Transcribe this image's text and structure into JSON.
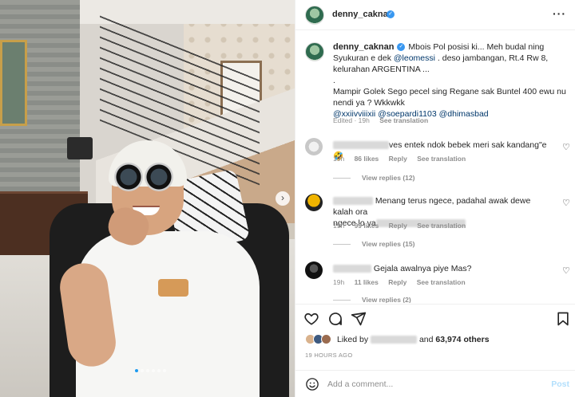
{
  "post": {
    "username": "denny_caknan",
    "caption_username": "denny_caknan",
    "caption_part1": "Mbois Pol posisi ki... Meh budal ning Syukuran e dek ",
    "mention_messi": "@leomessi",
    "caption_part2": " . deso jambangan, Rt.4 Rw 8, kelurahan ARGENTINA ...",
    "caption_dot": ".",
    "caption_part3": "Mampir Golek Sego pecel sing Regane sak Buntel 400 ewu nu nendi ya ? Wkkwkk",
    "mentions": [
      "@xxiivviiixii",
      "@soepardi1103",
      "@dhimasbad"
    ],
    "edited": "Edited · 19h",
    "see_translation": "See translation"
  },
  "comments": [
    {
      "text_suffix": "ves entek ndok bebek meri sak kandang\"e 🤣",
      "time": "19h",
      "likes": "86 likes",
      "reply": "Reply",
      "translation": "See translation",
      "view_replies": "View replies (12)"
    },
    {
      "text_line1": "Menang terus ngece, padahal awak dewe kalah ora",
      "text_line2": "ngece lo ya",
      "time": "19h",
      "likes": "99 likes",
      "reply": "Reply",
      "translation": "See translation",
      "view_replies": "View replies (15)"
    },
    {
      "text": "Gejala awalnya piye Mas?",
      "time": "19h",
      "likes": "11 likes",
      "reply": "Reply",
      "translation": "See translation",
      "view_replies": "View replies (2)"
    }
  ],
  "likes": {
    "prefix": "Liked by",
    "and": "and",
    "count": "63,974 others"
  },
  "time_ago": "19 HOURS AGO",
  "add_comment": {
    "placeholder": "Add a comment...",
    "post_label": "Post"
  },
  "icons": {
    "more": "more-icon",
    "next": "chevron-right-icon",
    "heart": "heart-icon",
    "comment": "comment-icon",
    "share": "share-icon",
    "save": "bookmark-icon",
    "emoji": "emoji-icon"
  },
  "carousel": {
    "total": 6,
    "active": 1
  },
  "colors": {
    "accent": "#3897f0",
    "link": "#00376b",
    "muted": "#8e8e8e",
    "post_disabled": "#b2dffc"
  }
}
